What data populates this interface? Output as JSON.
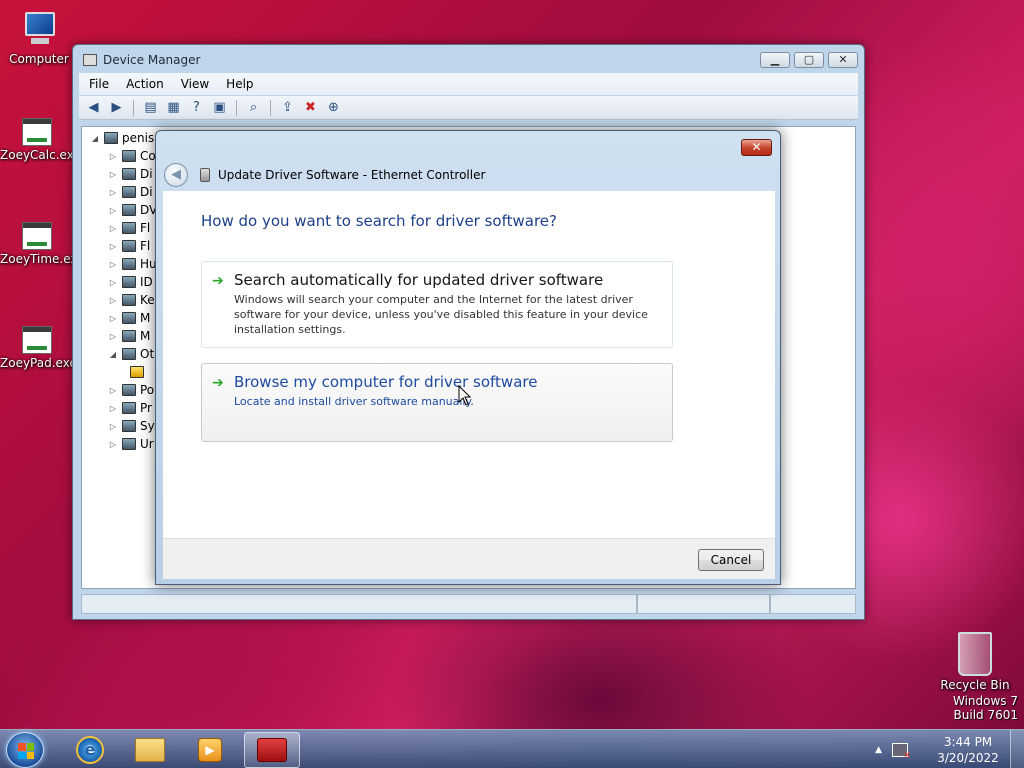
{
  "desktop": {
    "icons": [
      {
        "label": "Computer"
      },
      {
        "label": "ZoeyCalc.exe"
      },
      {
        "label": "ZoeyTime.exe"
      },
      {
        "label": "ZoeyPad.exe"
      },
      {
        "label": "Recycle Bin"
      }
    ],
    "watermark": {
      "line1": "Windows 7",
      "line2": "Build 7601"
    }
  },
  "device_manager": {
    "title": "Device Manager",
    "menu": [
      "File",
      "Action",
      "View",
      "Help"
    ],
    "tree_root": "penis",
    "tree_items": [
      "Co",
      "Di",
      "Di",
      "DV",
      "Fl",
      "Fl",
      "Hu",
      "ID",
      "Ke",
      "M",
      "M",
      "Ot",
      "",
      "Po",
      "Pr",
      "Sy",
      "Ur"
    ]
  },
  "dialog": {
    "title": "Update Driver Software - Ethernet Controller",
    "close": "✕",
    "question": "How do you want to search for driver software?",
    "option1": {
      "title": "Search automatically for updated driver software",
      "desc": "Windows will search your computer and the Internet for the latest driver software for your device, unless you've disabled this feature in your device installation settings."
    },
    "option2": {
      "title": "Browse my computer for driver software",
      "desc": "Locate and install driver software manually."
    },
    "cancel": "Cancel"
  },
  "taskbar": {
    "time": "3:44 PM",
    "date": "3/20/2022"
  },
  "colors": {
    "accent_text": "#1e3f8a",
    "link_text": "#1e4aa0",
    "arrow_green": "#2da52d",
    "close_red": "#c5422c"
  }
}
